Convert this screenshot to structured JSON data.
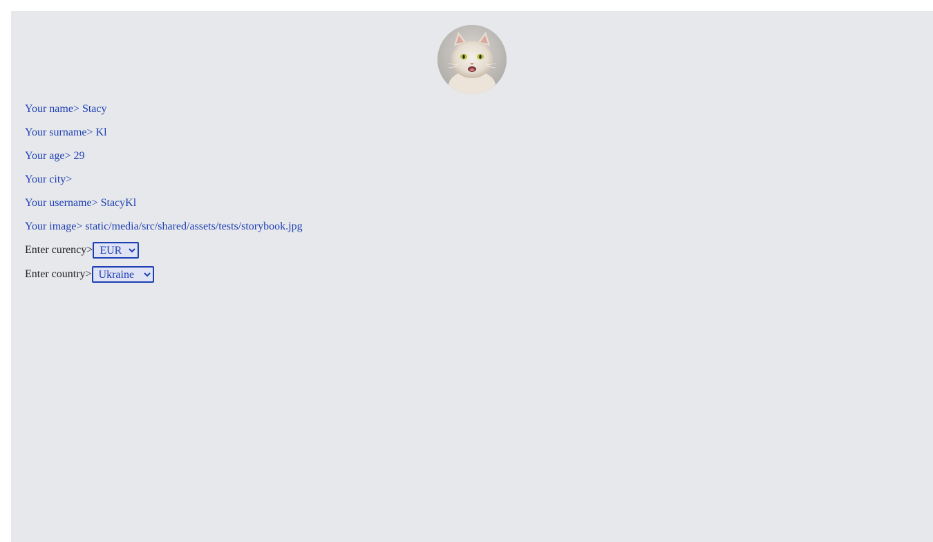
{
  "profile": {
    "avatar_alt": "cat avatar",
    "name_label": "Your name>",
    "name_value": "Stacy",
    "surname_label": "Your surname>",
    "surname_value": "Kl",
    "age_label": "Your age>",
    "age_value": "29",
    "city_label": "Your city>",
    "city_value": "",
    "username_label": "Your username>",
    "username_value": "StacyKl",
    "image_label": "Your image>",
    "image_value": "static/media/src/shared/assets/tests/storybook.jpg"
  },
  "currency": {
    "label": "Enter curency>",
    "selected": "EUR"
  },
  "country": {
    "label": "Enter country>",
    "selected": "Ukraine"
  },
  "colors": {
    "panel_bg": "#e7e8eb",
    "accent": "#1d3fb4"
  }
}
